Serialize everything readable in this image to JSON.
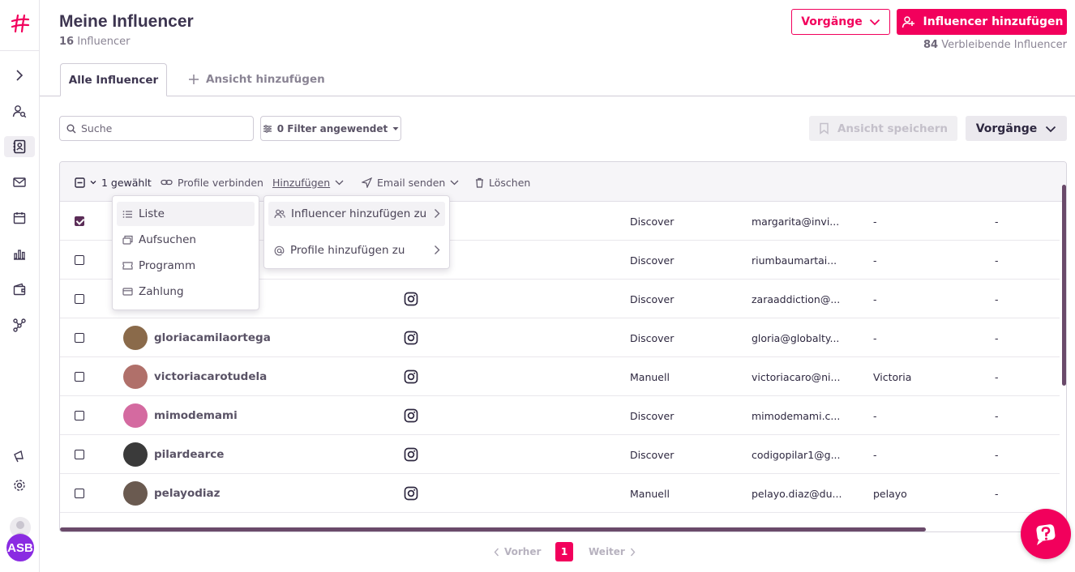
{
  "header": {
    "title": "Meine Influencer",
    "count_num": "16",
    "count_label": "Influencer",
    "vorgaenge_label": "Vorgänge",
    "add_influencer_label": "Influencer hinzufügen",
    "remaining_num": "84",
    "remaining_label": "Verbleibende Influencer"
  },
  "tabs": {
    "active": "Alle Influencer",
    "add": "Ansicht hinzufügen"
  },
  "toolbar": {
    "search_placeholder": "Suche",
    "filter_label": "0 Filter angewendet",
    "save_view_label": "Ansicht speichern",
    "vorgaenge_label": "Vorgänge"
  },
  "actionbar": {
    "selected": "1 gewählt",
    "connect": "Profile verbinden",
    "add": "Hinzufügen",
    "email": "Email senden",
    "delete": "Löschen"
  },
  "menu_add": {
    "items": [
      "Liste",
      "Aufsuchen",
      "Programm",
      "Zahlung"
    ]
  },
  "menu_sub": {
    "items": [
      "Influencer hinzufügen zu",
      "Profile hinzufügen zu"
    ]
  },
  "rows": [
    {
      "checked": true,
      "name": "",
      "platform": "",
      "source": "Discover",
      "email": "margarita@invi...",
      "first": "-",
      "last": "-",
      "avatar_color": "#e9e7ec"
    },
    {
      "checked": false,
      "name": "",
      "platform": "",
      "source": "Discover",
      "email": "riumbaumartai...",
      "first": "-",
      "last": "-",
      "avatar_color": "#e9e7ec"
    },
    {
      "checked": false,
      "name": "",
      "platform": "instagram",
      "source": "Discover",
      "email": "zaraaddiction@...",
      "first": "-",
      "last": "-",
      "avatar_color": "#e9e7ec"
    },
    {
      "checked": false,
      "name": "gloriacamilaortega",
      "platform": "instagram",
      "source": "Discover",
      "email": "gloria@globalty...",
      "first": "-",
      "last": "-",
      "avatar_color": "#8a6a4a"
    },
    {
      "checked": false,
      "name": "victoriacarotudela",
      "platform": "instagram",
      "source": "Manuell",
      "email": "victoriacaro@ni...",
      "first": "Victoria",
      "last": "-",
      "avatar_color": "#b0706a"
    },
    {
      "checked": false,
      "name": "mimodemami",
      "platform": "instagram",
      "source": "Discover",
      "email": "mimodemami.c...",
      "first": "-",
      "last": "-",
      "avatar_color": "#d46aa0"
    },
    {
      "checked": false,
      "name": "pilardearce",
      "platform": "instagram",
      "source": "Discover",
      "email": "codigopilar1@g...",
      "first": "-",
      "last": "-",
      "avatar_color": "#3a3a3a"
    },
    {
      "checked": false,
      "name": "pelayodiaz",
      "platform": "instagram",
      "source": "Manuell",
      "email": "pelayo.diaz@du...",
      "first": "pelayo",
      "last": "-",
      "avatar_color": "#6a5a50"
    }
  ],
  "pagination": {
    "prev": "Vorher",
    "current": "1",
    "next": "Weiter"
  },
  "user": {
    "initials": "ASB"
  },
  "colors": {
    "accent": "#f2005c",
    "primary_text": "#3d3550",
    "selected_checkbox": "#5b2d57"
  }
}
